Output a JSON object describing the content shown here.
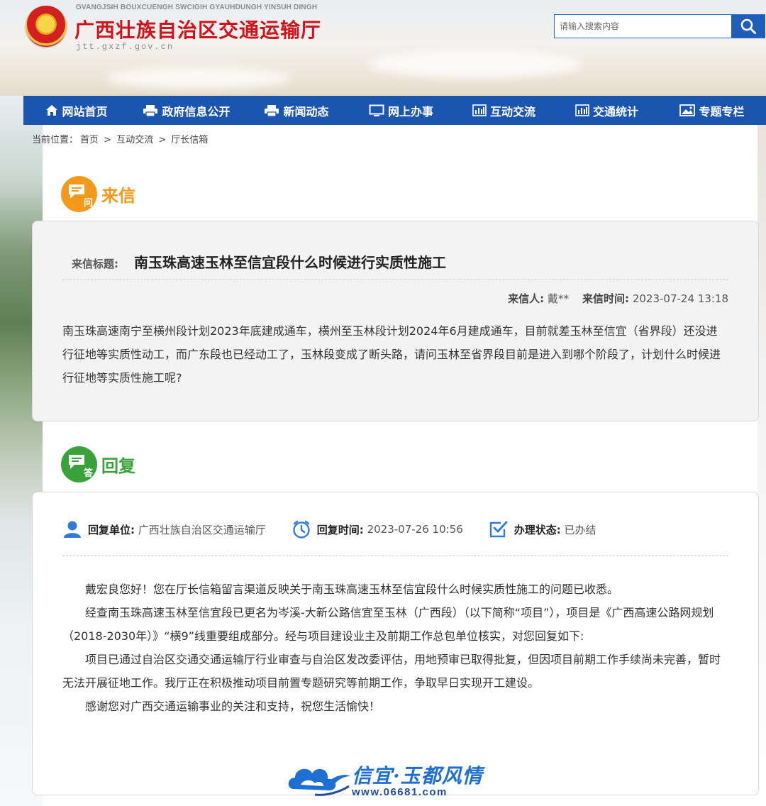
{
  "header": {
    "pinyin": "GVANGJSIH BOUXCUENGH SWCIGIH GYAUHDUNGH YINSUH DINGH",
    "title": "广西壮族自治区交通运输厅",
    "domain": "jtt.gxzf.gov.cn"
  },
  "search": {
    "placeholder": "请输入搜索内容"
  },
  "nav": [
    {
      "label": "网站首页",
      "icon": "home-icon"
    },
    {
      "label": "政府信息公开",
      "icon": "printer-icon"
    },
    {
      "label": "新闻动态",
      "icon": "printer-icon"
    },
    {
      "label": "网上办事",
      "icon": "monitor-icon"
    },
    {
      "label": "互动交流",
      "icon": "bar-chart-icon"
    },
    {
      "label": "交通统计",
      "icon": "bar-chart-icon"
    },
    {
      "label": "专题专栏",
      "icon": "image-icon"
    }
  ],
  "breadcrumb": {
    "prefix": "当前位置：",
    "items": [
      "首页",
      "互动交流",
      "厅长信箱"
    ],
    "separator": ">"
  },
  "letter": {
    "heading": "来信",
    "icon_glyph": "问",
    "title_label": "来信标题:",
    "title": "南玉珠高速玉林至信宜段什么时候进行实质性施工",
    "sender_label": "来信人:",
    "sender": "戴**",
    "time_label": "来信时间:",
    "time": "2023-07-24 13:18",
    "body": "南玉珠高速南宁至横州段计划2023年底建成通车，横州至玉林段计划2024年6月建成通车，目前就差玉林至信宜（省界段）还没进行征地等实质性动工，而广东段也已经动工了，玉林段变成了断头路，请问玉林至省界段目前是进入到哪个阶段了，计划什么时候进行征地等实质性施工呢?"
  },
  "reply": {
    "heading": "回复",
    "icon_glyph": "答",
    "unit_label": "回复单位:",
    "unit": "广西壮族自治区交通运输厅",
    "time_label": "回复时间:",
    "time": "2023-07-26 10:56",
    "status_label": "办理状态:",
    "status": "已办结",
    "paragraphs": [
      "戴宏良您好！您在厅长信箱留言渠道反映关于南玉珠高速玉林至信宜段什么时候实质性施工的问题已收悉。",
      "经查南玉珠高速玉林至信宜段已更名为岑溪-大新公路信宜至玉林（广西段）（以下简称“项目”），项目是《广西高速公路网规划（2018-2030年）》“横9”线重要组成部分。经与项目建设业主及前期工作总包单位核实，对您回复如下:",
      "项目已通过自治区交通交通运输厅行业审查与自治区发改委评估，用地预审已取得批复，但因项目前期工作手续尚未完善，暂时无法开展征地工作。我厅正在积极推动项目前置专题研究等前期工作，争取早日实现开工建设。",
      "感谢您对广西交通运输事业的关注和支持，祝您生活愉快！"
    ]
  },
  "watermark": {
    "text": "信宜·玉都风情",
    "url": "www.06681.com"
  },
  "colors": {
    "brand_red": "#d0131a",
    "nav_blue": "#1a55b0",
    "letter_orange": "#f39a1c",
    "reply_green": "#3aa23a",
    "reply_icon_blue": "#2f7bd6"
  }
}
